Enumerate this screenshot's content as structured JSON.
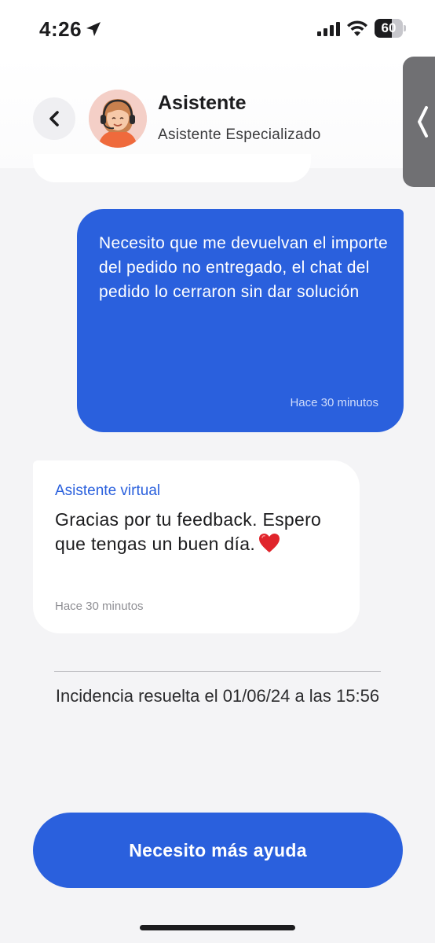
{
  "status_bar": {
    "time": "4:26",
    "battery_level": "60",
    "battery_fraction": 0.6,
    "icons": [
      "location-arrow-icon",
      "signal-icon",
      "wifi-icon",
      "battery-icon"
    ]
  },
  "header": {
    "title": "Asistente",
    "subtitle": "Asistente Especializado",
    "back_icon": "chevron-left-icon",
    "avatar": "assistant-avatar"
  },
  "chat": {
    "messages": [
      {
        "from": "user",
        "text": "Necesito que me devuelvan el importe del pedido no entregado, el chat del pedido lo cerraron sin dar solución",
        "time": "Hace 30 minutos"
      },
      {
        "from": "bot",
        "sender": "Asistente virtual",
        "text": "Gracias por tu feedback. Espero que tengas un buen día.",
        "emoji": "heart-icon",
        "time": "Hace 30 minutos"
      }
    ],
    "resolution": "Incidencia resuelta el 01/06/24 a las 15:56"
  },
  "actions": {
    "help_button": "Necesito más ayuda"
  },
  "colors": {
    "accent": "#2a60dd",
    "background": "#f4f4f6",
    "bubble_bot": "#ffffff"
  }
}
